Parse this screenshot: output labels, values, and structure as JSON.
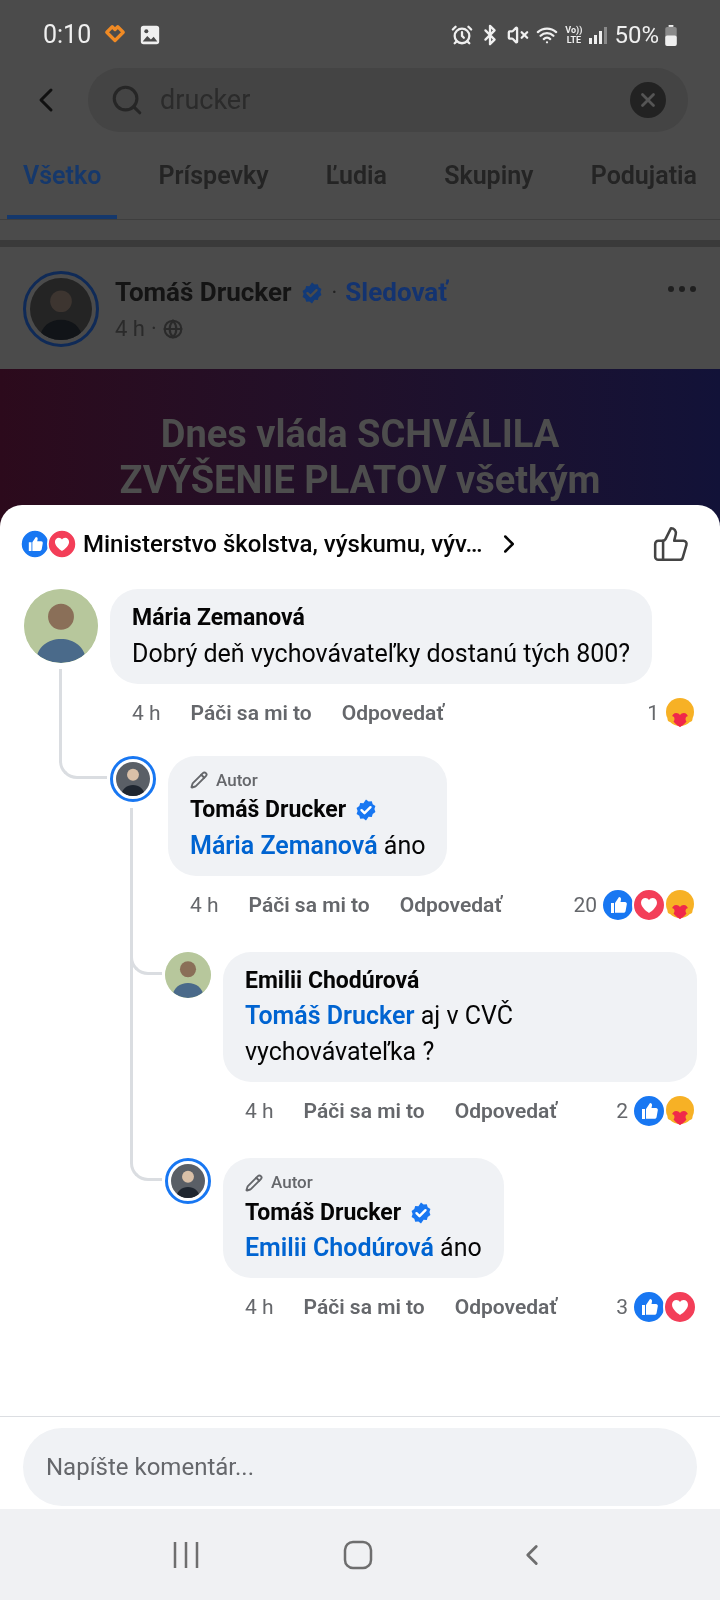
{
  "status_bar": {
    "time": "0:10",
    "network": [
      "Vo))",
      "LTE"
    ],
    "battery": "50%"
  },
  "search": {
    "value": "drucker"
  },
  "tabs": [
    {
      "label": "Všetko",
      "selected": true
    },
    {
      "label": "Príspevky",
      "selected": false
    },
    {
      "label": "Ľudia",
      "selected": false
    },
    {
      "label": "Skupiny",
      "selected": false
    },
    {
      "label": "Podujatia",
      "selected": false
    }
  ],
  "post": {
    "author": "Tomáš Drucker",
    "verified": true,
    "separator": "·",
    "follow": "Sledovať",
    "time": "4 h",
    "time_separator": "·",
    "headline": [
      "Dnes vláda SCHVÁLILA",
      "ZVÝŠENIE PLATOV všetkým"
    ]
  },
  "comments_sheet": {
    "reactions": [
      {
        "kind": "like"
      },
      {
        "kind": "love"
      }
    ],
    "title": "Ministerstvo školstva, výskumu, výv…",
    "comments": [
      {
        "author": "Mária Zemanová",
        "verified": false,
        "text": "Dobrý deň vychovávateľky dostanú tých 800?",
        "time": "4 h",
        "like": "Páči sa mi to",
        "reply": "Odpovedať",
        "reaction_count": "1",
        "reactions": [
          {
            "kind": "care"
          }
        ],
        "children": [
          {
            "author": "Tomáš Drucker",
            "verified": true,
            "badge": "Autor",
            "mention": "Mária Zemanová",
            "text": "áno",
            "time": "4 h",
            "like": "Páči sa mi to",
            "reply": "Odpovedať",
            "reaction_count": "20",
            "reactions": [
              {
                "kind": "like"
              },
              {
                "kind": "love"
              },
              {
                "kind": "care"
              }
            ],
            "children": [
              {
                "author": "Emilii Chodúrová",
                "verified": false,
                "mention": "Tomáš Drucker",
                "text": "aj v CVČ vychovávateľka ?",
                "time": "4 h",
                "like": "Páči sa mi to",
                "reply": "Odpovedať",
                "reaction_count": "2",
                "reactions": [
                  {
                    "kind": "like"
                  },
                  {
                    "kind": "care"
                  }
                ]
              },
              {
                "author": "Tomáš Drucker",
                "verified": true,
                "badge": "Autor",
                "mention": "Emilii Chodúrová",
                "text": "áno",
                "time": "4 h",
                "like": "Páči sa mi to",
                "reply": "Odpovedať",
                "reaction_count": "3",
                "reactions": [
                  {
                    "kind": "like"
                  },
                  {
                    "kind": "love"
                  }
                ]
              }
            ]
          }
        ]
      }
    ],
    "composer": {
      "placeholder": "Napíšte komentár..."
    }
  }
}
